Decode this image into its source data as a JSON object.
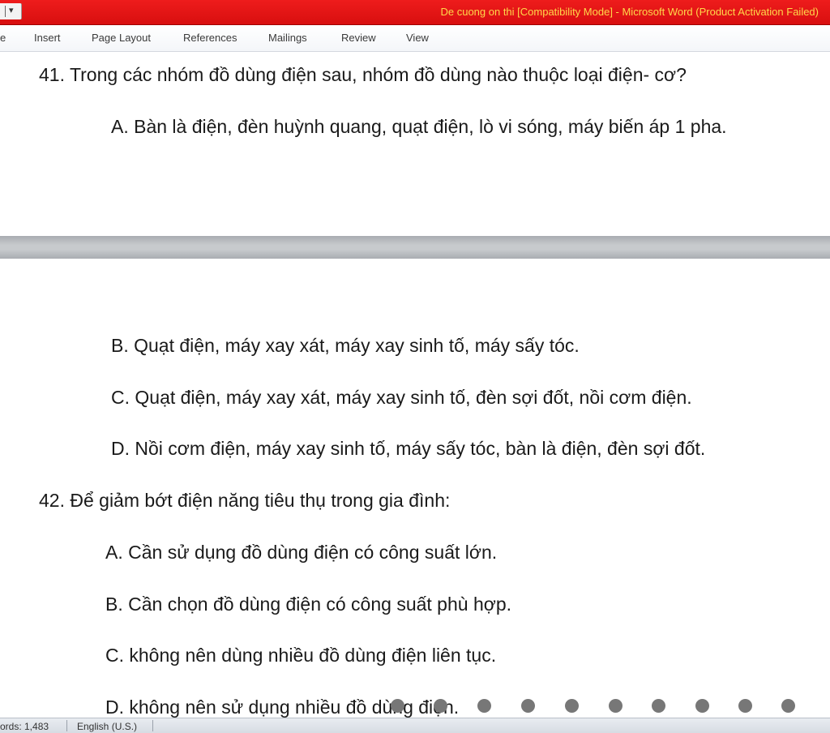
{
  "window": {
    "title": "De cuong on thi [Compatibility Mode]  -  Microsoft Word (Product Activation Failed)",
    "qat_arrow": "▾"
  },
  "ribbon": {
    "tabs": [
      "e",
      "Insert",
      "Page Layout",
      "References",
      "Mailings",
      "Review",
      "View"
    ]
  },
  "document": {
    "q41": {
      "question": "41. Trong các nhóm đồ dùng điện sau, nhóm đồ dùng nào thuộc loại điện- cơ?",
      "a": "A. Bàn là điện, đèn huỳnh quang, quạt điện, lò vi sóng, máy biến áp 1 pha.",
      "b": "B. Quạt điện, máy xay xát, máy xay sinh tố, máy sấy tóc.",
      "c": "C. Quạt điện, máy xay xát, máy xay sinh tố, đèn sợi đốt, nồi cơm điện.",
      "d": "D. Nồi cơm điện, máy xay sinh tố, máy sấy tóc, bàn là điện, đèn sợi đốt."
    },
    "q42": {
      "question": "42. Để giảm bớt điện năng tiêu thụ trong gia đình:",
      "a": "A. Cần sử dụng đồ dùng điện có công suất lớn.",
      "b": "B. Cần chọn đồ dùng điện có công suất phù hợp.",
      "c": "C. không nên dùng nhiều đồ dùng điện liên tục.",
      "d": "D. không nên sử dụng nhiều đồ dùng điện."
    }
  },
  "statusbar": {
    "words": "ords: 1,483",
    "language": "English (U.S.)"
  },
  "overlay": {
    "dot_color": "#777777"
  }
}
